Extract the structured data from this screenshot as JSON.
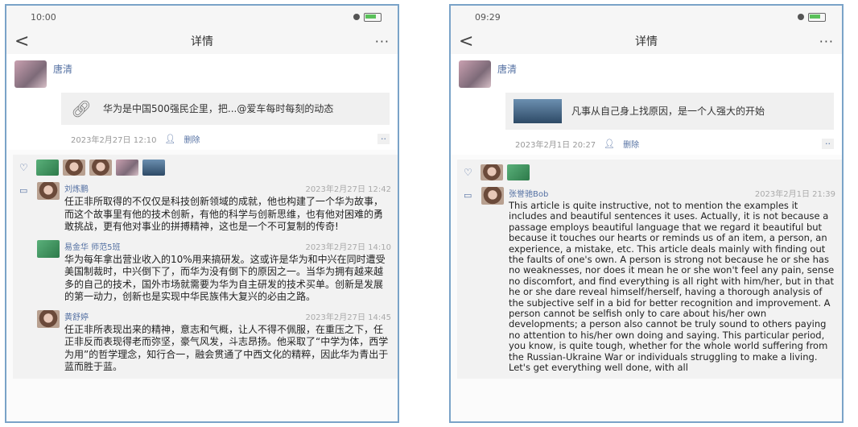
{
  "left": {
    "status": {
      "time": "10:00"
    },
    "nav": {
      "back": "<",
      "title": "详情",
      "more": "···"
    },
    "post": {
      "author": "唐清",
      "share_text": "华为是中国500强民企里，把...@爱车每时每刻的动态",
      "time": "2023年2月27日 12:10",
      "delete_label": "删除",
      "more": "··"
    },
    "comments": [
      {
        "name": "刘炼鹏",
        "time": "2023年2月27日 12:42",
        "text": "任正非所取得的不仅仅是科技创新领域的成就，他也构建了一个华为故事，而这个故事里有他的技术创新，有他的科学与创新思维，也有他对困难的勇敢挑战，更有他对事业的拼搏精神，这也是一个不可复制的传奇!"
      },
      {
        "name": "易金华 师范5班",
        "time": "2023年2月27日 14:10",
        "text": "华为每年拿出营业收入的10%用来搞研发。这或许是华为和中兴在同时遭受美国制裁时，中兴倒下了，而华为没有倒下的原因之一。当华为拥有越来越多的自己的技术，国外市场就需要为华为自主研发的技术买单。创新是发展的第一动力，创新也是实现中华民族伟大复兴的必由之路。"
      },
      {
        "name": "黄舒婷",
        "time": "2023年2月27日 14:45",
        "text": "任正非所表现出来的精神，意志和气概，让人不得不佩服，在重压之下，任正非反而表现得老而弥坚，豪气风发，斗志昂扬。他采取了“中学为体，西学为用”的哲学理念，知行合一，融会贯通了中西文化的精粹，因此华为青出于蓝而胜于蓝。"
      }
    ]
  },
  "right": {
    "status": {
      "time": "09:29"
    },
    "nav": {
      "back": "<",
      "title": "详情",
      "more": "···"
    },
    "post": {
      "author": "唐清",
      "share_text": "凡事从自己身上找原因，是一个人强大的开始",
      "time": "2023年2月1日 20:27",
      "delete_label": "删除",
      "more": "··"
    },
    "comments": [
      {
        "name": "张誉驰Bob",
        "time": "2023年2月1日 21:39",
        "text": "This article is quite instructive, not to mention the examples it includes and beautiful sentences it uses. Actually, it is not because a passage employs beautiful language that we regard it beautiful but because it touches our hearts or reminds us of an item, a person, an experience, a mistake, etc. This article deals mainly with finding out the faults of one's own. A person is strong not because he or she has no weaknesses, nor does it mean he or she won't feel any pain, sense no discomfort, and find everything is all right with him/her, but in that he or she dare reveal himself/herself, having a thorough analysis of the subjective self in a bid for better recognition and improvement. A person cannot be selfish only to care about his/her own developments; a person also cannot be truly sound to others paying no attention to his/her own doing and saying. This particular period, you know, is quite tough, whether for the whole world suffering from the Russian-Ukraine War or individuals struggling to make a living. Let's get everything well done, with all"
      }
    ]
  }
}
